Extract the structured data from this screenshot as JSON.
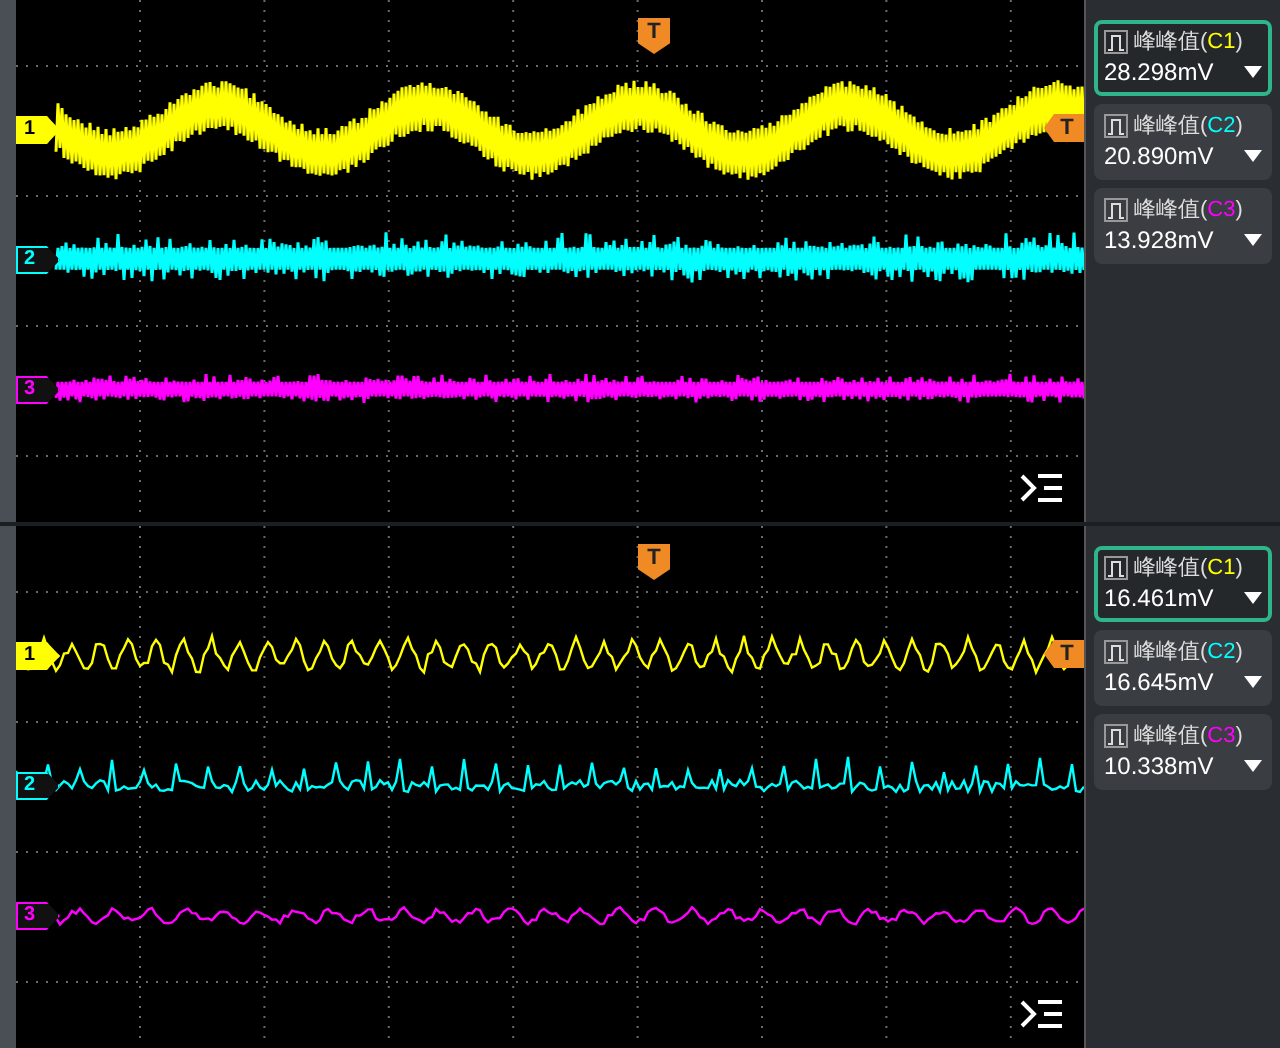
{
  "panels": [
    {
      "trigger": {
        "top_label": "T",
        "level_label": "T"
      },
      "channels": [
        {
          "label": "1",
          "color": "#ffff00",
          "kind": "sine-band",
          "selected": true
        },
        {
          "label": "2",
          "color": "#00ffff",
          "kind": "noise-band",
          "selected": false
        },
        {
          "label": "3",
          "color": "#ff00ff",
          "kind": "thin-band",
          "selected": false
        }
      ],
      "measurements": [
        {
          "title_prefix": "峰峰值(",
          "channel": "C1",
          "title_suffix": ")",
          "color": "#ffff00",
          "value": "28.298mV",
          "selected": true
        },
        {
          "title_prefix": "峰峰值(",
          "channel": "C2",
          "title_suffix": ")",
          "color": "#00ffff",
          "value": "20.890mV",
          "selected": false
        },
        {
          "title_prefix": "峰峰值(",
          "channel": "C3",
          "title_suffix": ")",
          "color": "#ff00ff",
          "value": "13.928mV",
          "selected": false
        }
      ]
    },
    {
      "trigger": {
        "top_label": "T",
        "level_label": "T"
      },
      "channels": [
        {
          "label": "1",
          "color": "#ffff00",
          "kind": "triangle",
          "selected": true
        },
        {
          "label": "2",
          "color": "#00ffff",
          "kind": "spikes",
          "selected": false
        },
        {
          "label": "3",
          "color": "#ff00ff",
          "kind": "ripple",
          "selected": false
        }
      ],
      "measurements": [
        {
          "title_prefix": "峰峰值(",
          "channel": "C1",
          "title_suffix": ")",
          "color": "#ffff00",
          "value": "16.461mV",
          "selected": true
        },
        {
          "title_prefix": "峰峰值(",
          "channel": "C2",
          "title_suffix": ")",
          "color": "#00ffff",
          "value": "16.645mV",
          "selected": false
        },
        {
          "title_prefix": "峰峰值(",
          "channel": "C3",
          "title_suffix": ")",
          "color": "#ff00ff",
          "value": "10.338mV",
          "selected": false
        }
      ]
    }
  ]
}
